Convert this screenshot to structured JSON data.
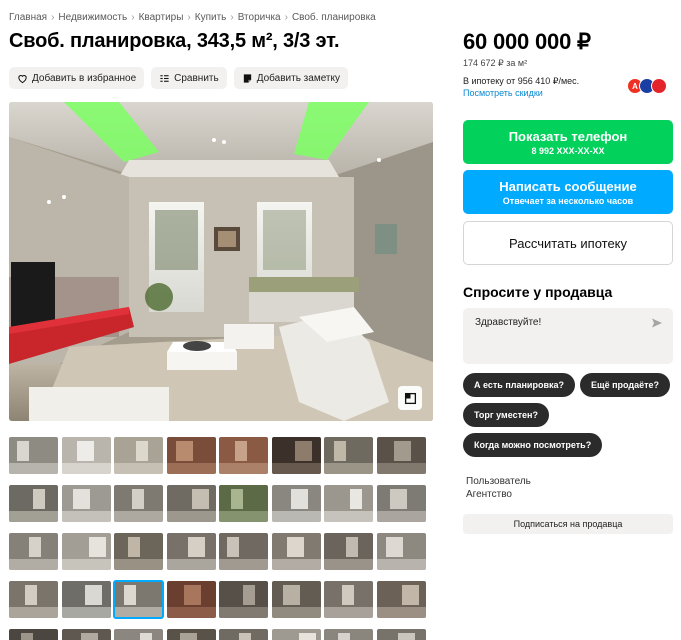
{
  "breadcrumbs": [
    "Главная",
    "Недвижимость",
    "Квартиры",
    "Купить",
    "Вторичка",
    "Своб. планировка"
  ],
  "breadcrumb_separator": "›",
  "title": "Своб. планировка, 343,5 м², 3/3 эт.",
  "actions": {
    "favorite": "Добавить в избранное",
    "compare": "Сравнить",
    "note": "Добавить заметку"
  },
  "price": {
    "value": "60 000 000 ₽",
    "per_sqm": "174 672 ₽ за м²",
    "mortgage": "В ипотеку от 956 410 ₽/мес.",
    "discounts_link": "Посмотреть скидки"
  },
  "banks": [
    {
      "letter": "А",
      "color": "#ef3124"
    },
    {
      "letter": "",
      "color": "#1a3fa3"
    },
    {
      "letter": "",
      "color": "#e3242b"
    }
  ],
  "contact": {
    "show_phone": "Показать телефон",
    "phone_masked": "8 992 XXX-XX-XX",
    "write_message": "Написать сообщение",
    "reply_time": "Отвечает за несколько часов",
    "calc_mortgage": "Рассчитать ипотеку"
  },
  "ask": {
    "title": "Спросите у продавца",
    "placeholder": "Здравствуйте!",
    "chips": [
      "А есть планировка?",
      "Ещё продаёте?",
      "Торг уместен?",
      "Когда можно посмотреть?"
    ]
  },
  "seller": {
    "role": "Пользователь",
    "name": "Агентство",
    "subscribe": "Подписаться на продавца"
  },
  "gallery": {
    "thumb_count": 40,
    "active_thumb": 26,
    "thumb_palettes": [
      [
        "#8e8b83",
        "#d8d6cf"
      ],
      [
        "#b9b5ad",
        "#eeece8"
      ],
      [
        "#a9a396",
        "#ddd8cc"
      ],
      [
        "#7a4d3a",
        "#b98b6e"
      ],
      [
        "#8a5a44",
        "#c7a28a"
      ],
      [
        "#3b302a",
        "#8d7b6c"
      ],
      [
        "#6e6a5f",
        "#bfb8a8"
      ],
      [
        "#5a5148",
        "#a39a8e"
      ],
      [
        "#6c6a62",
        "#cfcac0"
      ],
      [
        "#9d9a93",
        "#e4e1dc"
      ],
      [
        "#7f7a71",
        "#d3cfc6"
      ],
      [
        "#706b62",
        "#c3bdb2"
      ],
      [
        "#5c6a45",
        "#a8b58f"
      ],
      [
        "#8a8780",
        "#e2e0da"
      ],
      [
        "#9b978f",
        "#e9e7e2"
      ],
      [
        "#7e7b74",
        "#cdc9c1"
      ],
      [
        "#858178",
        "#d6d2ca"
      ],
      [
        "#a29e95",
        "#e6e3dd"
      ],
      [
        "#6c655a",
        "#bfb6a8"
      ],
      [
        "#77716a",
        "#d5cfc6"
      ],
      [
        "#6f6961",
        "#c9c2b8"
      ],
      [
        "#807a71",
        "#dcd6cd"
      ],
      [
        "#6a645c",
        "#c1bab0"
      ],
      [
        "#8d8880",
        "#ddd9d2"
      ],
      [
        "#7a746b",
        "#d2ccc2"
      ],
      [
        "#6e6d68",
        "#d9d8d3"
      ],
      [
        "#7c7870",
        "#dcd8d0"
      ],
      [
        "#6a3f30",
        "#a8755d"
      ],
      [
        "#565048",
        "#a59d92"
      ],
      [
        "#625c52",
        "#b8b0a3"
      ],
      [
        "#77716a",
        "#cfc9bf"
      ],
      [
        "#6b6157",
        "#c2b6a8"
      ],
      [
        "#4b463f",
        "#9c958a"
      ],
      [
        "#5e5851",
        "#b1aa9f"
      ],
      [
        "#8b8780",
        "#dedbd5"
      ],
      [
        "#585248",
        "#aaa297"
      ],
      [
        "#6f6a62",
        "#c8c2b8"
      ],
      [
        "#9e9a92",
        "#e7e4de"
      ],
      [
        "#8a857d",
        "#d7d3cc"
      ],
      [
        "#77726a",
        "#cbc6bd"
      ]
    ]
  }
}
